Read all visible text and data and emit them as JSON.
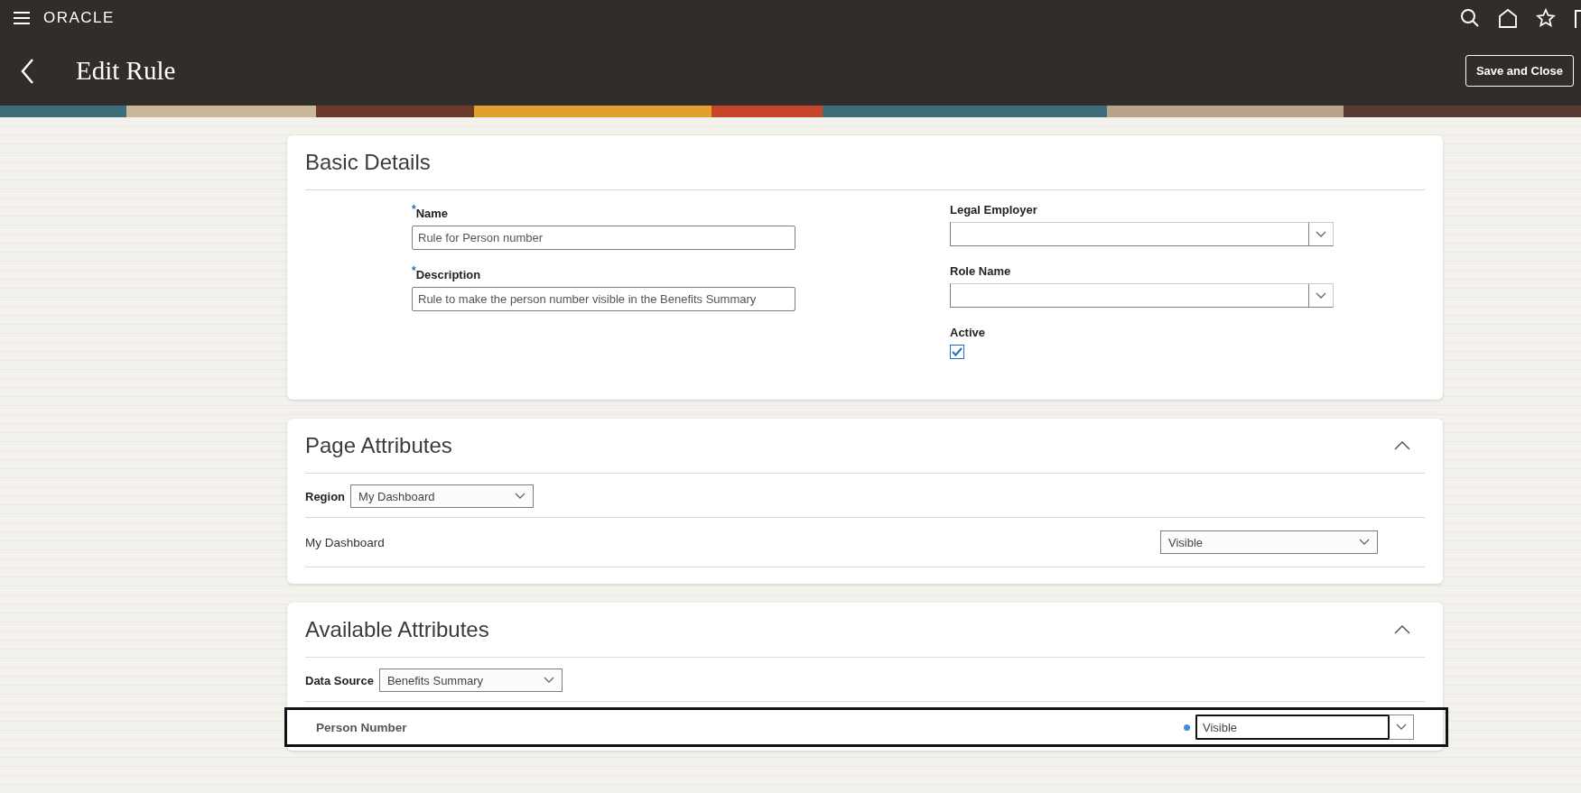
{
  "header": {
    "logo": "ORACLE",
    "title": "Edit Rule",
    "save_button": "Save and Close"
  },
  "basic_details": {
    "title": "Basic Details",
    "required_mark": "*",
    "left_fields": [
      {
        "label": "Name",
        "required": true,
        "value": "Rule for Person number"
      },
      {
        "label": "Description",
        "required": true,
        "value": "Rule to make the person number visible in the Benefits Summary"
      }
    ],
    "right_fields": [
      {
        "label": "Legal Employer"
      },
      {
        "label": "Role Name"
      }
    ],
    "active": {
      "label": "Active",
      "checked": true
    }
  },
  "page_attributes": {
    "title": "Page Attributes",
    "expanded": true,
    "filter_label": "Region",
    "filter_value": "My Dashboard",
    "rows": [
      {
        "name": "My Dashboard",
        "value": "Visible",
        "modified": false,
        "focused": false,
        "highlighted": false
      }
    ]
  },
  "available_attributes": {
    "title": "Available Attributes",
    "expanded": true,
    "filter_label": "Data Source",
    "filter_value": "Benefits Summary",
    "rows": [
      {
        "name": "Person Number",
        "value": "Visible",
        "modified": true,
        "focused": true,
        "highlighted": true
      }
    ]
  }
}
